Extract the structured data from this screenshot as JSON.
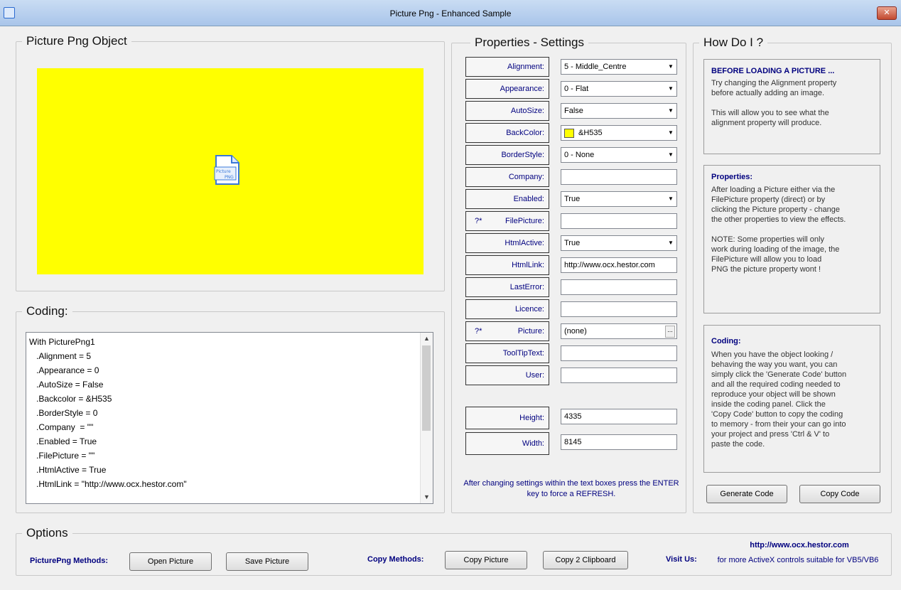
{
  "window": {
    "title": "Picture Png - Enhanced Sample",
    "close_glyph": "✕"
  },
  "picture_group": {
    "legend": "Picture Png Object",
    "backcolor": "#FFFF00",
    "icon_text": [
      "Picture",
      "PNG"
    ]
  },
  "coding_group": {
    "legend": "Coding:",
    "lines": [
      "With PicturePng1",
      "   .Alignment = 5",
      "   .Appearance = 0",
      "   .AutoSize = False",
      "   .Backcolor = &H535",
      "   .BorderStyle = 0",
      "   .Company  = \"\"",
      "   .Enabled = True",
      "   .FilePicture = \"\"",
      "   .HtmlActive = True",
      "   .HtmlLink = \"http://www.ocx.hestor.com\""
    ]
  },
  "properties": {
    "legend": "Properties  -  Settings",
    "rows": [
      {
        "label": "Alignment:",
        "value": "5 - Middle_Centre",
        "kind": "combo"
      },
      {
        "label": "Appearance:",
        "value": "0 - Flat",
        "kind": "combo"
      },
      {
        "label": "AutoSize:",
        "value": "False",
        "kind": "combo"
      },
      {
        "label": "BackColor:",
        "value": "&H535",
        "kind": "color"
      },
      {
        "label": "BorderStyle:",
        "value": "0 - None",
        "kind": "combo"
      },
      {
        "label": "Company:",
        "value": "",
        "kind": "text"
      },
      {
        "label": "Enabled:",
        "value": "True",
        "kind": "combo"
      },
      {
        "label": "FilePicture:",
        "value": "",
        "kind": "text",
        "prefix": "?*"
      },
      {
        "label": "HtmlActive:",
        "value": "True",
        "kind": "combo"
      },
      {
        "label": "HtmlLink:",
        "value": "http://www.ocx.hestor.com",
        "kind": "text"
      },
      {
        "label": "LastError:",
        "value": "",
        "kind": "text"
      },
      {
        "label": "Licence:",
        "value": "",
        "kind": "text"
      },
      {
        "label": "Picture:",
        "value": "(none)",
        "kind": "dots",
        "prefix": "?*"
      },
      {
        "label": "ToolTipText:",
        "value": "",
        "kind": "text"
      },
      {
        "label": "User:",
        "value": "",
        "kind": "text"
      }
    ],
    "size_rows": [
      {
        "label": "Height:",
        "value": "4335"
      },
      {
        "label": "Width:",
        "value": "8145"
      }
    ],
    "note": "After changing settings within the text boxes press the ENTER key to force a REFRESH."
  },
  "howdoi": {
    "legend": "How Do I ?",
    "box1": {
      "heading": "BEFORE LOADING A PICTURE ...",
      "text": "Try changing the Alignment property\nbefore actually adding an image.\n\nThis will allow you to see what the\nalignment property will produce."
    },
    "box2": {
      "heading": "Properties:",
      "text": "After loading a Picture either via the\nFilePicture property (direct) or by\nclicking the Picture property - change\nthe other properties to view the effects.\n\nNOTE: Some properties will only\nwork during loading of the image, the\nFilePicture will allow you to load\nPNG the picture property wont !"
    },
    "box3": {
      "heading": "Coding:",
      "text": "When you have the object looking /\nbehaving the way you want, you can\nsimply click the 'Generate Code' button\nand all the required coding needed to\nreproduce your object will be shown\ninside the coding panel. Click the\n'Copy Code' button to copy the coding\nto memory - from their your can go into\nyour project and press 'Ctrl & V' to\npaste the code."
    },
    "generate_button": "Generate Code",
    "copy_code_button": "Copy Code"
  },
  "options": {
    "legend": "Options",
    "methods_label": "PicturePng Methods:",
    "open_button": "Open Picture",
    "save_button": "Save Picture",
    "copy_label": "Copy Methods:",
    "copy_picture_button": "Copy Picture",
    "copy_clipboard_button": "Copy 2 Clipboard",
    "visit_label": "Visit Us:",
    "visit_url": "http://www.ocx.hestor.com",
    "visit_text": "for more ActiveX controls suitable for VB5/VB6"
  }
}
